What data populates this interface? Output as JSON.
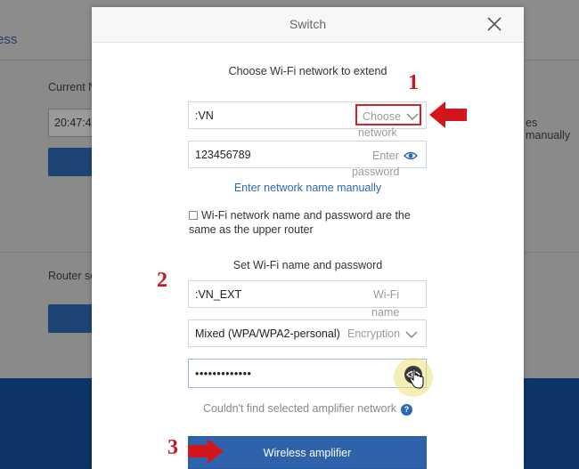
{
  "modal": {
    "title": "Switch",
    "section1_title": "Choose Wi-Fi network to extend",
    "network_field": {
      "value": ":VN",
      "hint_line1": "Choose",
      "hint_line2": "network"
    },
    "password_field": {
      "value": "123456789",
      "hint_line1": "Enter",
      "hint_line2": "password"
    },
    "manual_link": "Enter network name manually",
    "same_checkbox_label": "Wi-Fi network name and password are the same as the upper router",
    "section2_title": "Set Wi-Fi name and password",
    "wifi_name_field": {
      "value": ":VN_EXT",
      "hint_line1": "Wi-Fi",
      "hint_line2": "name"
    },
    "security_select": {
      "value": "Mixed (WPA/WPA2-personal)",
      "hint": "Encryption"
    },
    "new_password_field": {
      "value": "•••••••••••••"
    },
    "not_found_text": "Couldn't find selected amplifier network",
    "help_icon": "?",
    "submit_label": "Wireless amplifier"
  },
  "background": {
    "partial_title": "ess",
    "current_label": "Current N",
    "time_value": "20:47:4",
    "router_label": "Router se",
    "right_text": "es manually"
  },
  "annotations": {
    "step1": "1",
    "step2": "2",
    "step3": "3"
  },
  "colors": {
    "accent_blue": "#2e63ab",
    "annotation_red": "#c8181f",
    "footer_navy": "#0d3567"
  }
}
